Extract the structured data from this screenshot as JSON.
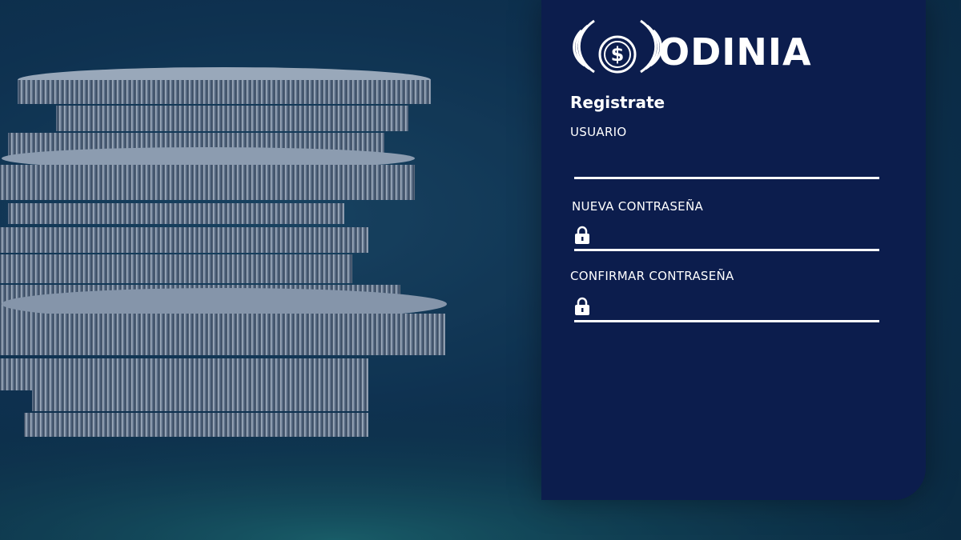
{
  "brand": {
    "name": "ODINIA",
    "logo_icon": "winged-coin-dollar-icon"
  },
  "form": {
    "title": "Registrate",
    "fields": [
      {
        "label": "USUARIO",
        "value": "",
        "icon": ""
      },
      {
        "label": "NUEVA CONTRASEÑA",
        "value": "",
        "icon": "lock-icon"
      },
      {
        "label": "CONFIRMAR CONTRASEÑA",
        "value": "",
        "icon": "lock-icon"
      }
    ]
  },
  "colors": {
    "panel": "#0c1d4d",
    "text": "#ffffff",
    "background": "#0f3350"
  }
}
